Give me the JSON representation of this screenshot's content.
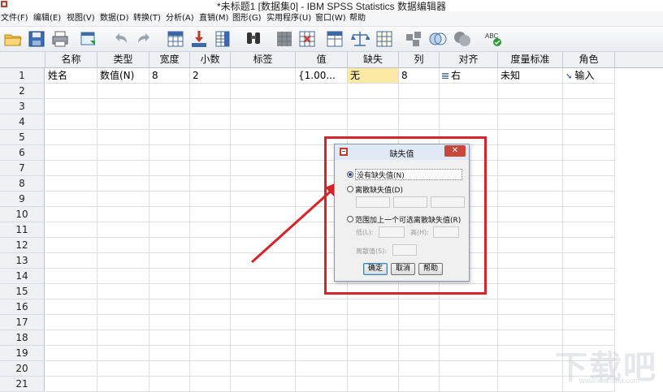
{
  "window": {
    "title": "*未标题1 [数据集0] - IBM SPSS Statistics 数据编辑器"
  },
  "menu": [
    "文件(F)",
    "编辑(E)",
    "视图(V)",
    "数据(D)",
    "转换(T)",
    "分析(A)",
    "直销(M)",
    "图形(G)",
    "实用程序(U)",
    "窗口(W)",
    "帮助"
  ],
  "toolbar": {
    "icons": [
      "open-icon",
      "save-icon",
      "print-icon",
      "recall-dialog-icon",
      "undo-icon",
      "redo-icon",
      "goto-case-icon",
      "goto-variable-icon",
      "variables-icon",
      "find-icon",
      "insert-cases-icon",
      "insert-variable-icon",
      "split-file-icon",
      "weight-cases-icon",
      "select-cases-icon",
      "value-labels-icon",
      "use-sets-icon",
      "show-all-variables-icon",
      "spell-check-icon"
    ],
    "spell_label": "ABC"
  },
  "grid": {
    "columns": [
      "名称",
      "类型",
      "宽度",
      "小数",
      "标签",
      "值",
      "缺失",
      "列",
      "对齐",
      "度量标准",
      "角色"
    ],
    "row_numbers": [
      "1",
      "2",
      "3",
      "4",
      "5",
      "6",
      "7",
      "8",
      "9",
      "10",
      "11",
      "12",
      "13",
      "14",
      "15",
      "16",
      "17",
      "18",
      "19",
      "20",
      "21"
    ],
    "rows": [
      [
        "姓名",
        "数值(N)",
        "8",
        "2",
        "",
        "{1.00...",
        "无",
        "8",
        "右",
        "未知",
        "输入"
      ]
    ]
  },
  "dialog": {
    "title": "缺失值",
    "close_label": "✕",
    "option_none": "没有缺失值(N)",
    "option_discrete": "离散缺失值(D)",
    "option_range": "范围加上一个可选离散缺失值(R)",
    "low_label": "低(L):",
    "high_label": "高(H):",
    "discrete_value_label": "离散值(S):",
    "ok": "确定",
    "cancel": "取消",
    "help": "帮助",
    "selected_option": "none"
  },
  "watermark": {
    "text": "下载吧",
    "url": "www.xiazaiba.com"
  },
  "colors": {
    "highlight": "#d8232a",
    "selected_cell": "#fde9a6",
    "header_bg": "#eef0f4"
  }
}
